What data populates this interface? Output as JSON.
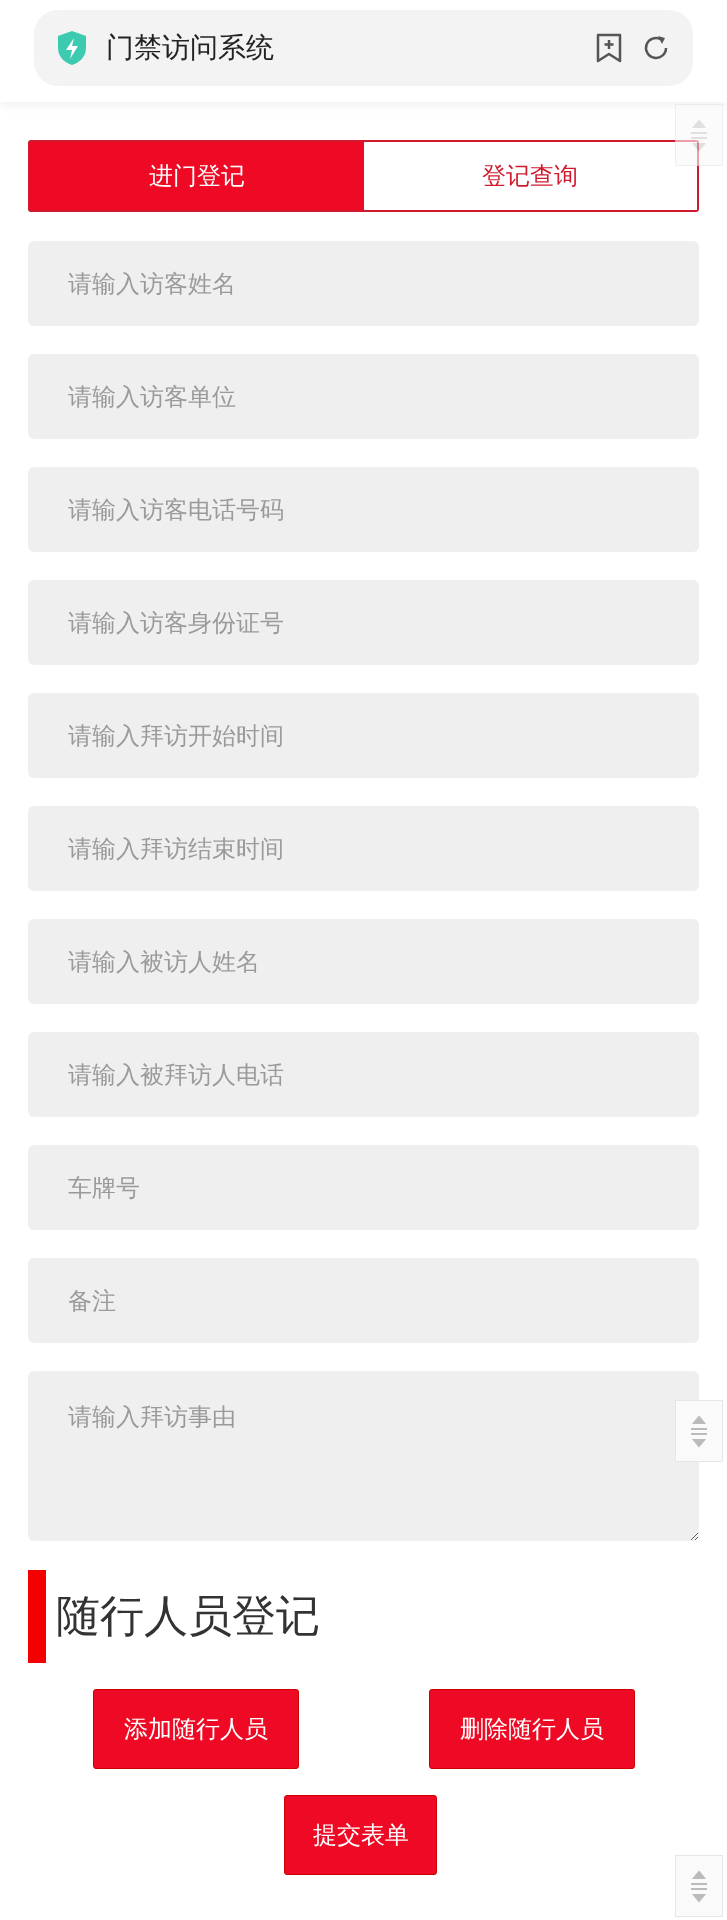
{
  "header": {
    "title": "门禁访问系统"
  },
  "tabs": [
    {
      "label": "进门登记",
      "selected": true
    },
    {
      "label": "登记查询",
      "selected": false
    }
  ],
  "fields": [
    {
      "kind": "input",
      "placeholder": "请输入访客姓名"
    },
    {
      "kind": "input",
      "placeholder": "请输入访客单位"
    },
    {
      "kind": "input",
      "placeholder": "请输入访客电话号码"
    },
    {
      "kind": "input",
      "placeholder": "请输入访客身份证号"
    },
    {
      "kind": "input",
      "placeholder": "请输入拜访开始时间"
    },
    {
      "kind": "input",
      "placeholder": "请输入拜访结束时间"
    },
    {
      "kind": "input",
      "placeholder": "请输入被访人姓名"
    },
    {
      "kind": "input",
      "placeholder": "请输入被拜访人电话"
    },
    {
      "kind": "input",
      "placeholder": "车牌号"
    },
    {
      "kind": "input",
      "placeholder": "备注"
    },
    {
      "kind": "textarea",
      "placeholder": "请输入拜访事由"
    }
  ],
  "section": {
    "title": "随行人员登记"
  },
  "companion_buttons": [
    "添加随行人员",
    "删除随行人员"
  ],
  "submit_button": "提交表单"
}
